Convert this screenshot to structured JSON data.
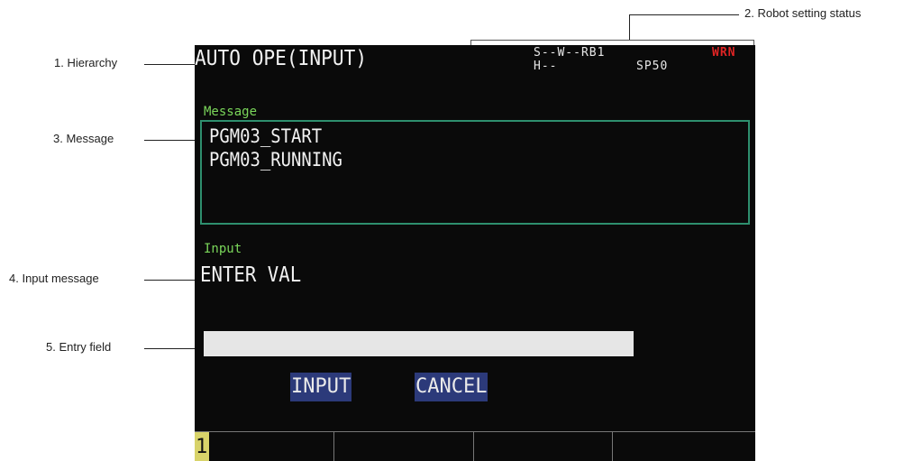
{
  "callouts": {
    "hierarchy": "1. Hierarchy",
    "robot_status": "2. Robot setting status",
    "message": "3. Message",
    "input_message": "4. Input message",
    "entry_field": "5. Entry field"
  },
  "screen": {
    "hierarchy": "AUTO OPE(INPUT)",
    "status": {
      "line1": "S--W--RB1",
      "line2": "H--",
      "speed": "SP50",
      "warning": "WRN"
    },
    "message_section": {
      "label": "Message",
      "lines": [
        "PGM03_START",
        "PGM03_RUNNING"
      ]
    },
    "input_section": {
      "label": "Input",
      "message": "ENTER VAL"
    },
    "entry_field": {
      "value": ""
    },
    "buttons": {
      "input": "INPUT",
      "cancel": "CANCEL"
    },
    "function_keys": {
      "page_number": "1"
    }
  },
  "colors": {
    "screen_bg": "#0a0a0a",
    "label_green": "#7ad65a",
    "message_box_border": "#2e8f6e",
    "warning_red": "#e02424",
    "button_blue": "#2c3a7a",
    "page_indicator_yellow": "#d8d36a"
  }
}
